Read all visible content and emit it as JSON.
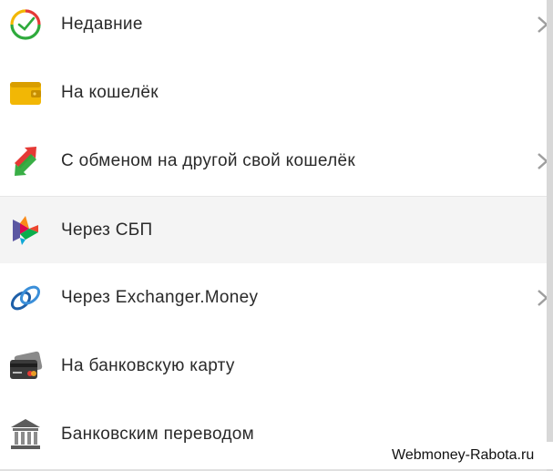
{
  "menu": {
    "items": [
      {
        "label": "Недавние",
        "icon": "recent-clock-icon",
        "has_chevron": true
      },
      {
        "label": "На кошелёк",
        "icon": "wallet-icon",
        "has_chevron": false
      },
      {
        "label": "С обменом на другой свой кошелёк",
        "icon": "exchange-arrows-icon",
        "has_chevron": true
      },
      {
        "label": "Через СБП",
        "icon": "sbp-logo-icon",
        "has_chevron": false,
        "active": true
      },
      {
        "label": "Через Exchanger.Money",
        "icon": "exchanger-link-icon",
        "has_chevron": true
      },
      {
        "label": "На банковскую карту",
        "icon": "bank-card-icon",
        "has_chevron": false
      },
      {
        "label": "Банковским переводом",
        "icon": "bank-building-icon",
        "has_chevron": false
      }
    ]
  },
  "watermark": "Webmoney-Rabota.ru",
  "colors": {
    "active_row": "#f4f4f4",
    "wallet": "#f2b705",
    "exchange_red": "#e53935",
    "exchange_green": "#2eaa3c",
    "link_blue": "#1e5fa8"
  }
}
